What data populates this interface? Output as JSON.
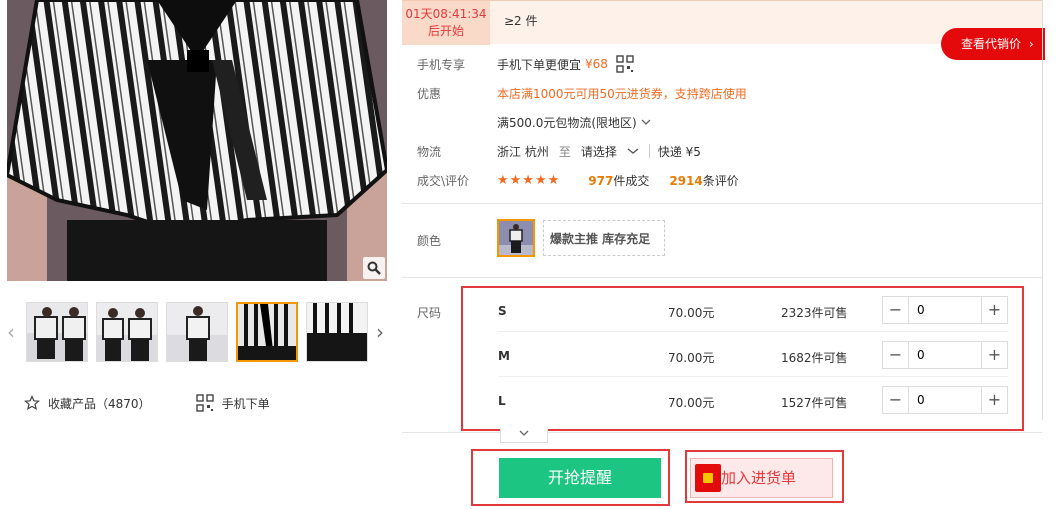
{
  "gallery": {
    "zoom_icon": "zoom-icon",
    "prev_icon": "chevron-left-icon",
    "next_icon": "chevron-right-icon",
    "thumb_count": 5,
    "active_thumb": 4,
    "favorite_label": "收藏产品",
    "favorite_count": "（4870）",
    "mobile_order_label": "手机下单"
  },
  "promo": {
    "countdown_time": "01天08:41:34",
    "countdown_label": "后开始",
    "min_quantity": "≥2 件",
    "agent_price_button": "查看代销价",
    "agent_price_arrow": "›"
  },
  "info": {
    "mobile_label": "手机专享",
    "mobile_text": "手机下单更便宜",
    "mobile_price": "¥68",
    "discount_label": "优惠",
    "discount_text": "本店满1000元可用50元进货券，支持跨店使用",
    "shipping_free_text": "满500.0元包物流(限地区)",
    "logistics_label": "物流",
    "origin": "浙江 杭州",
    "to": "至",
    "destination_placeholder": "请选择",
    "express": "快递 ¥5",
    "deals_label": "成交\\评价",
    "stars": "★★★★★",
    "deal_count": "977",
    "deal_unit": "件成交",
    "review_count": "2914",
    "review_unit": "条评价"
  },
  "color": {
    "label": "颜色",
    "tag": "爆款主推 库存充足"
  },
  "sizes": {
    "label": "尺码",
    "rows": [
      {
        "size": "S",
        "price": "70.00元",
        "stock": "2323件可售",
        "qty": "0"
      },
      {
        "size": "M",
        "price": "70.00元",
        "stock": "1682件可售",
        "qty": "0"
      },
      {
        "size": "L",
        "price": "70.00元",
        "stock": "1527件可售",
        "qty": "0"
      }
    ],
    "minus": "−",
    "plus": "+",
    "expand_icon": "chevron-down-icon"
  },
  "actions": {
    "start_reminder": "开抢提醒",
    "add_to_purchase": "加入进货单"
  },
  "colors": {
    "accent_red": "#e4393c",
    "green_button": "#1cc682",
    "orange": "#f26a21"
  }
}
